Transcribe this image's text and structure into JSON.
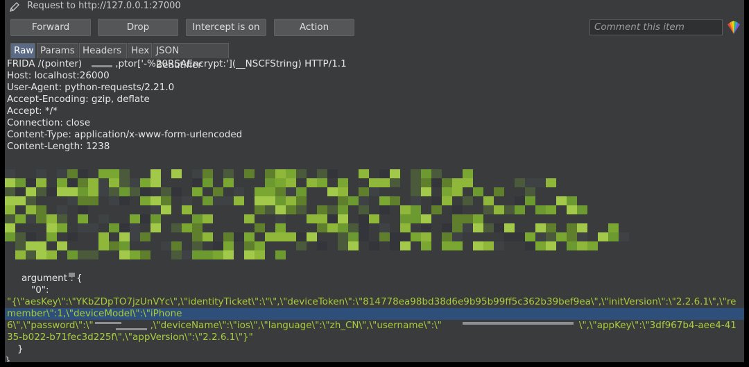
{
  "window": {
    "title": "Request to http://127.0.0.1:27000"
  },
  "toolbar": {
    "forward_label": "Forward",
    "drop_label": "Drop",
    "intercept_label": "Intercept is on",
    "action_label": "Action",
    "comment_placeholder": "Comment this item"
  },
  "tabs": [
    {
      "label": "Raw",
      "active": true
    },
    {
      "label": "Params",
      "active": false
    },
    {
      "label": "Headers",
      "active": false
    },
    {
      "label": "Hex",
      "active": false
    },
    {
      "label": "JSON Beautifier",
      "active": false
    }
  ],
  "request": {
    "line1_prefix": "FRIDA /(pointer)",
    "line1_suffix": ",ptor['-%20RSAEncrypt:'](__NSCFString) HTTP/1.1",
    "headers": [
      "Host: localhost:26000",
      "User-Agent: python-requests/2.21.0",
      "Accept-Encoding: gzip, deflate",
      "Accept: */*",
      "Connection: close",
      "Content-Type: application/x-www-form-urlencoded",
      "Content-Length: 1238"
    ]
  },
  "body": {
    "argument_label": "argument",
    "argument_tail": " : {",
    "key0": "\"0\":",
    "json_line1": "\"{\\\"aesKey\\\":\\\"YKbZDpTO7jzUnVYc\\\",\\\"identityTicket\\\":\\\"\\\",\\\"deviceToken\\\":\\\"814778ea98bd38d6e9b95b99ff5c362b39bef9ea\\\",\\\"initVersion\\\":\\\"2.2.6.1\\\",\\\"re",
    "json_line2": "member\\\":1,\\\"deviceModel\\\":\\\"iPhone",
    "json_line3a": "6\\\",\\\"password\\\":\\\"",
    "json_line3b": ",\\\"deviceName\\\":\\\"ios\\\",\\\"language\\\":\\\"zh_CN\\\",\\\"username\\\":\\\"",
    "json_line3c": "\\\",\\\"appKey\\\":\\\"3df967b4-aee4-41",
    "json_line4": "35-b022-b71fec3d225f\\\",\\\"appVersion\\\":\\\"2.2.6.1\\\"}\"",
    "close_inner": "}",
    "close_outer": "}"
  },
  "colors": {
    "background": "#3a3b3d",
    "json_green": "#a8cc3c",
    "highlight": "#2d4f7a",
    "pixel_green": "#8fb83a"
  },
  "icons": {
    "title": "pencil-icon",
    "logo": "burp-logo-icon"
  }
}
